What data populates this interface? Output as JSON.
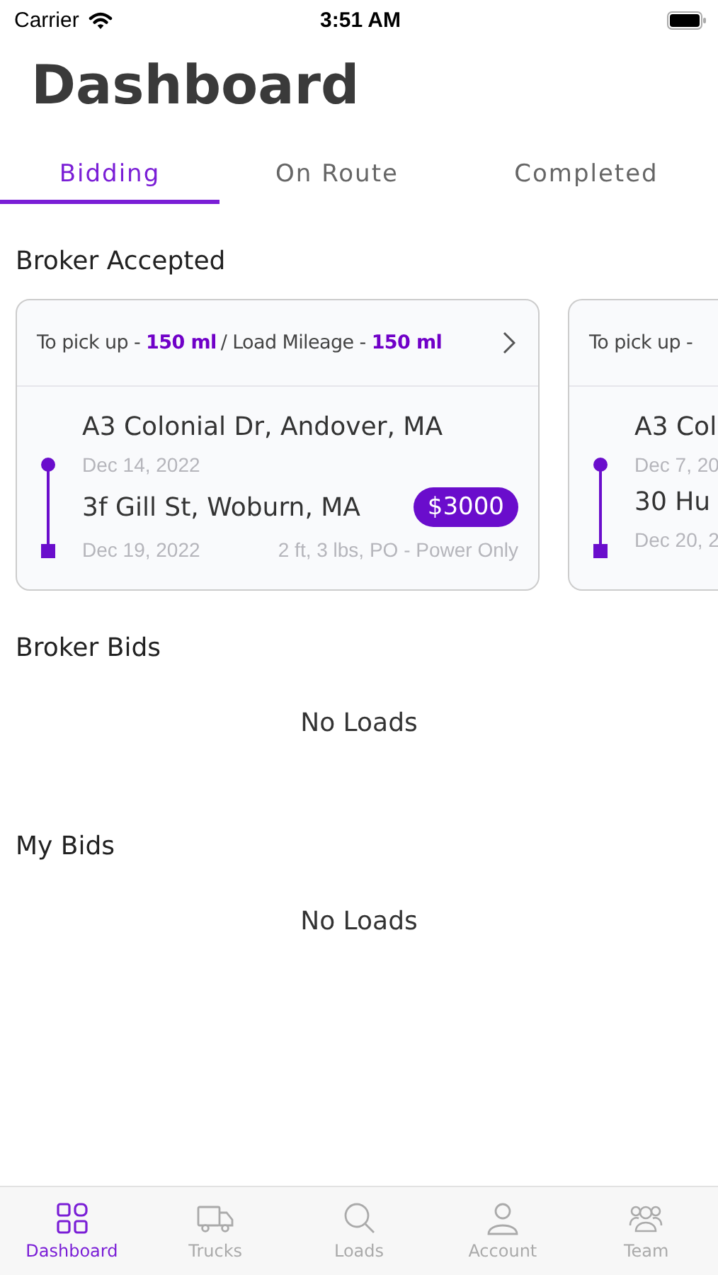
{
  "status_bar": {
    "carrier": "Carrier",
    "time": "3:51 AM"
  },
  "title": "Dashboard",
  "tabs": [
    {
      "label": "Bidding",
      "selected": true
    },
    {
      "label": "On Route",
      "selected": false
    },
    {
      "label": "Completed",
      "selected": false
    }
  ],
  "sections": [
    {
      "title": "Broker Accepted",
      "cards": [
        {
          "pickup_label": "To pick up -",
          "pickup_value": "150 ml",
          "mileage_label": "/ Load Mileage -",
          "mileage_value": "150 ml",
          "origin": "A3 Colonial Dr, Andover, MA",
          "origin_date": "Dec 14, 2022",
          "destination": "3f Gill St, Woburn, MA",
          "destination_date": "Dec 19, 2022",
          "price": "$3000",
          "details": "2 ft, 3 lbs, PO - Power Only"
        },
        {
          "pickup_label": "To pick up -",
          "origin": "A3 Col",
          "origin_date": "Dec 7, 20",
          "destination": "30 Hu",
          "destination_date": "Dec 20, 2"
        }
      ]
    },
    {
      "title": "Broker Bids",
      "empty_text": "No Loads"
    },
    {
      "title": "My Bids",
      "empty_text": "No Loads"
    }
  ],
  "bottom_nav": [
    {
      "label": "Dashboard",
      "selected": true
    },
    {
      "label": "Trucks",
      "selected": false
    },
    {
      "label": "Loads",
      "selected": false
    },
    {
      "label": "Account",
      "selected": false
    },
    {
      "label": "Team",
      "selected": false
    }
  ]
}
